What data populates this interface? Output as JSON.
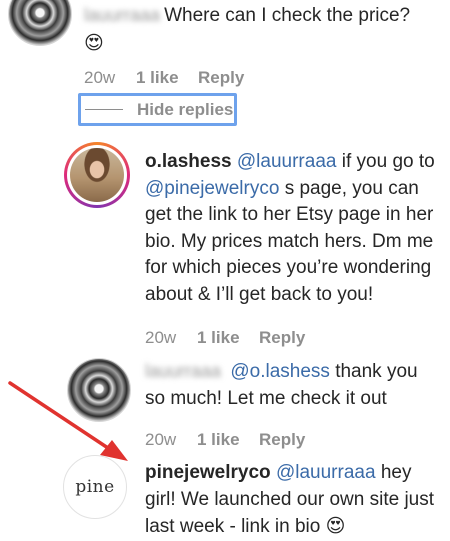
{
  "comments": [
    {
      "id": "top",
      "username_blurred": "lauurraaa",
      "text": "Where can I check the price?",
      "emoji": "😍",
      "meta": {
        "time": "20w",
        "likes": "1 like",
        "reply": "Reply"
      }
    },
    {
      "id": "olashess",
      "username": "o.lashess",
      "mention": "@lauurraaa",
      "text_lines": [
        "if you go to",
        "s page, you can",
        "get the link to her Etsy page in her",
        "bio. My prices match hers. Dm me",
        "for which pieces you’re wondering",
        "about & I’ll get back to you!"
      ],
      "mention2": "@pinejewelryco",
      "meta": {
        "time": "20w",
        "likes": "1 like",
        "reply": "Reply"
      }
    },
    {
      "id": "lauurraaa-reply",
      "username_blurred": "lauurraaa",
      "mention": "@o.lashess",
      "text_line1": "thank you",
      "text_line2": "so much! Let me check it out",
      "meta": {
        "time": "20w",
        "likes": "1 like",
        "reply": "Reply"
      }
    },
    {
      "id": "pinejewelryco",
      "username": "pinejewelryco",
      "mention": "@lauurraaa",
      "text_line1": "hey",
      "text_line2": "girl! We launched our own site just",
      "text_line3": "last week - link in bio",
      "emoji": "😍",
      "avatar_text": "pine"
    }
  ],
  "hide_replies": {
    "label": "Hide replies"
  },
  "colors": {
    "mention": "#3b6ba8",
    "meta": "#8e8e8e",
    "focus_outline": "#6ea2ec",
    "arrow": "#e0332f"
  }
}
